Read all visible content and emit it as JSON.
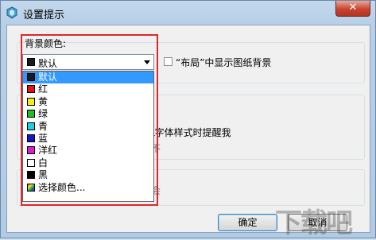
{
  "window": {
    "title": "设置提示",
    "close_glyph": "✕"
  },
  "background_color": {
    "label": "背景颜色:",
    "selected": "默认",
    "selected_swatch": "#1a1a1a",
    "options": [
      {
        "label": "默认",
        "swatch": "#1a1a1a"
      },
      {
        "label": "红",
        "swatch": "#e21313"
      },
      {
        "label": "黄",
        "swatch": "#f0ee12"
      },
      {
        "label": "绿",
        "swatch": "#22c01c"
      },
      {
        "label": "青",
        "swatch": "#19d2e0"
      },
      {
        "label": "蓝",
        "swatch": "#1515c8"
      },
      {
        "label": "洋红",
        "swatch": "#d81fd0"
      },
      {
        "label": "白",
        "swatch": "#ffffff"
      },
      {
        "label": "黑",
        "swatch": "#000000"
      },
      {
        "label": "选择颜色...",
        "swatch": "multicolor"
      }
    ]
  },
  "layout_checkbox": {
    "label": "“布局”中显示图纸背景"
  },
  "middle_group": {
    "text_partial": "L字体样式时提醒我",
    "stub_text": "不"
  },
  "bottom_group": {
    "stub_text": "会"
  },
  "buttons": {
    "ok": "确定",
    "cancel": "取消"
  },
  "watermark": "下载吧"
}
